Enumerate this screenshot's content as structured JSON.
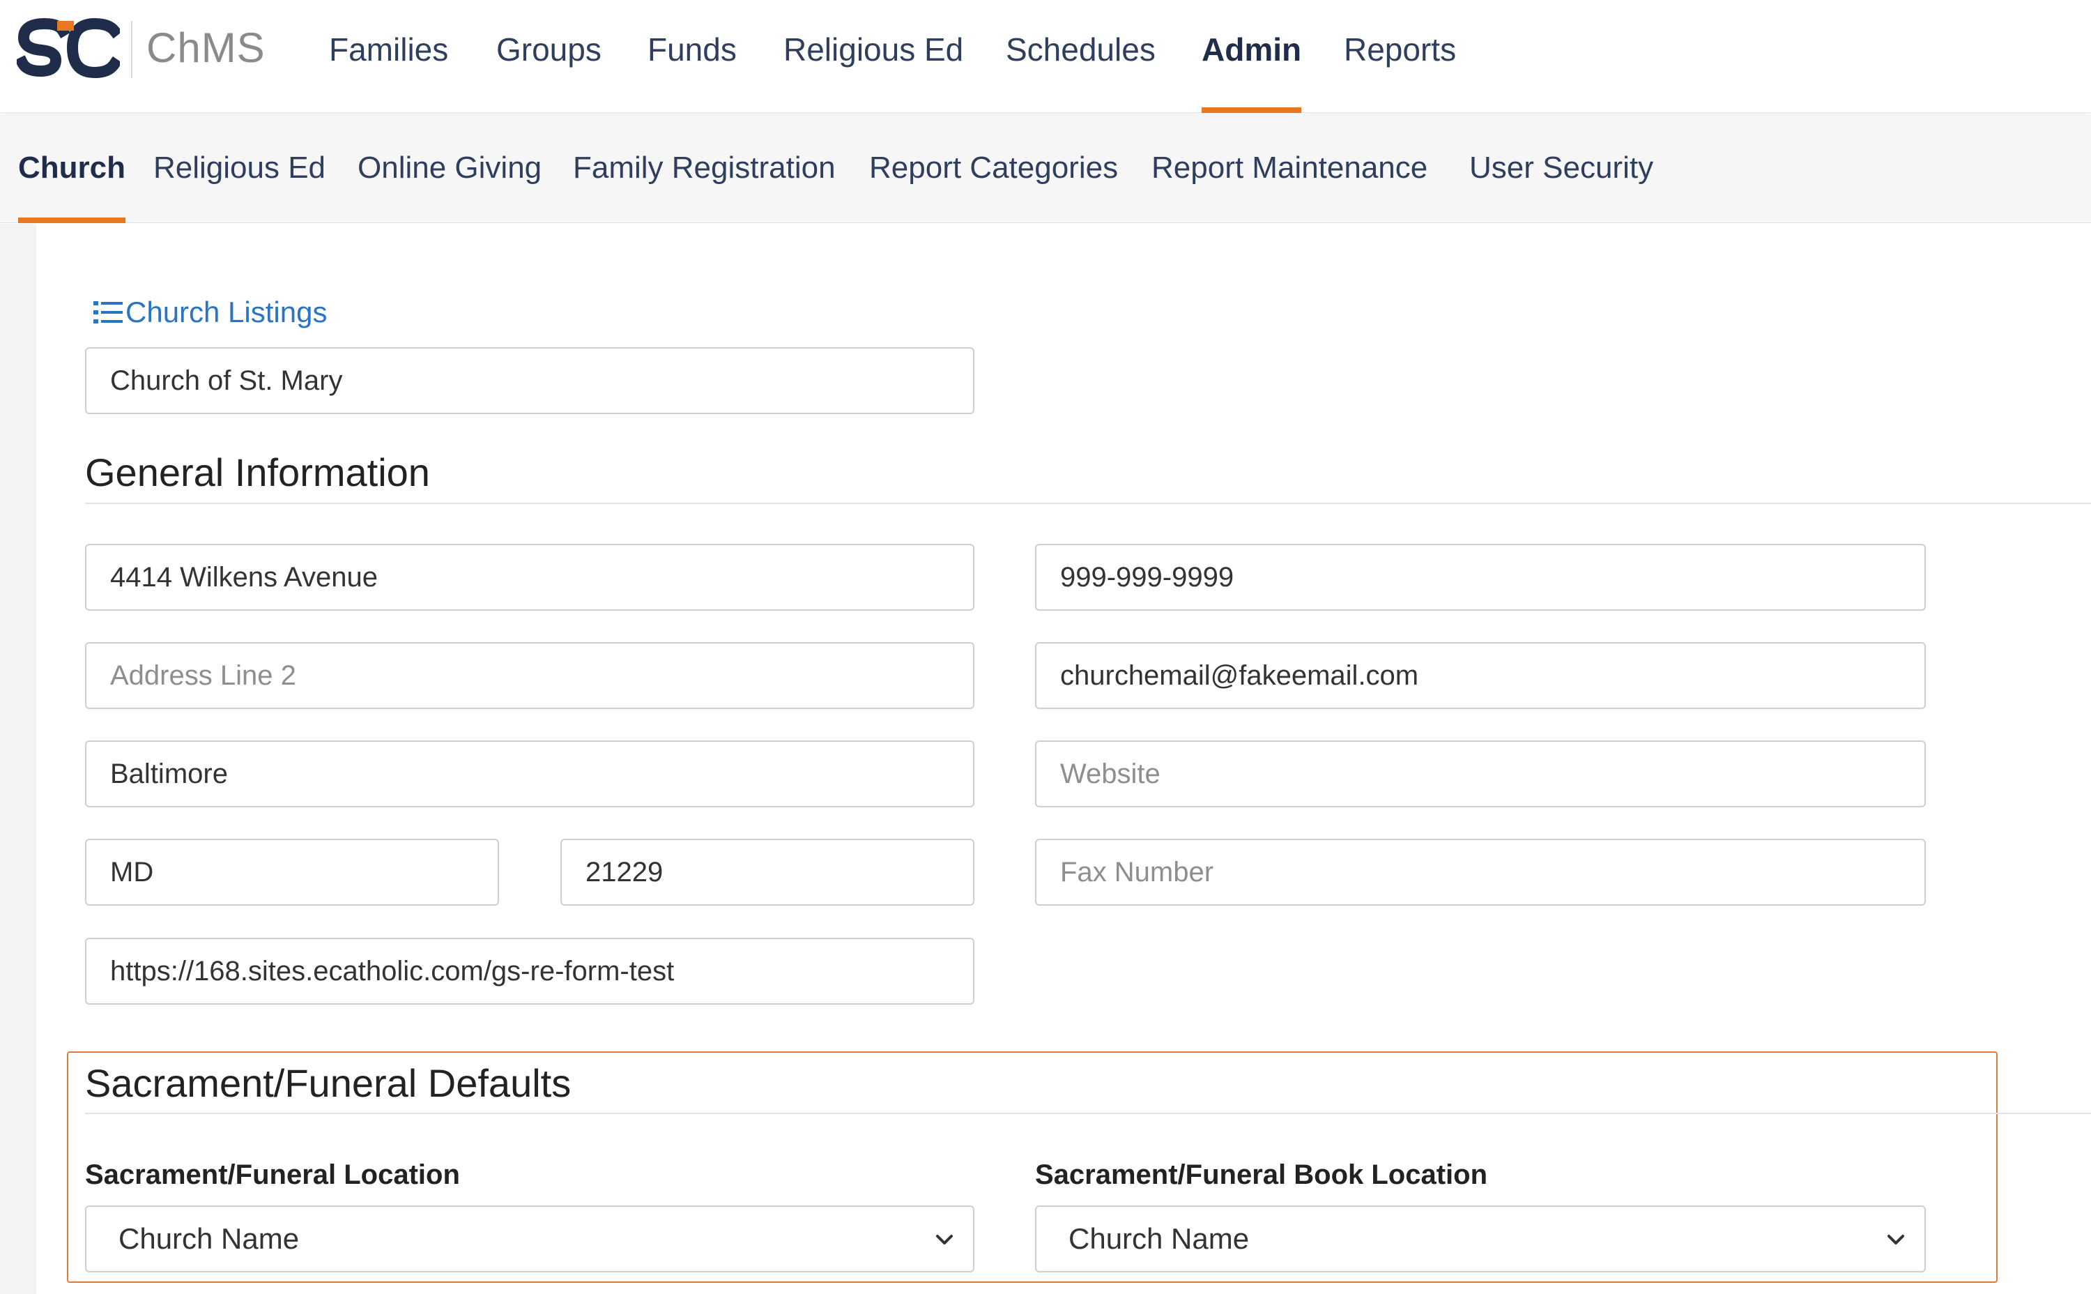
{
  "app": {
    "brand_letters": "SC",
    "name": "ChMS"
  },
  "topnav": {
    "items": [
      {
        "label": "Families"
      },
      {
        "label": "Groups"
      },
      {
        "label": "Funds"
      },
      {
        "label": "Religious Ed"
      },
      {
        "label": "Schedules"
      },
      {
        "label": "Admin",
        "active": true
      },
      {
        "label": "Reports"
      }
    ]
  },
  "subnav": {
    "items": [
      {
        "label": "Church",
        "active": true
      },
      {
        "label": "Religious Ed"
      },
      {
        "label": "Online Giving"
      },
      {
        "label": "Family Registration"
      },
      {
        "label": "Report Categories"
      },
      {
        "label": "Report Maintenance"
      },
      {
        "label": "User Security"
      }
    ]
  },
  "church": {
    "listings_link": "Church Listings",
    "name_value": "Church of St. Mary"
  },
  "general": {
    "title": "General Information",
    "address1": "4414 Wilkens Avenue",
    "address2_placeholder": "Address Line 2",
    "city": "Baltimore",
    "state": "MD",
    "zip": "21229",
    "url": "https://168.sites.ecatholic.com/gs-re-form-test",
    "phone": "999-999-9999",
    "email": "churchemail@fakeemail.com",
    "website_placeholder": "Website",
    "fax_placeholder": "Fax Number"
  },
  "sacrament": {
    "title": "Sacrament/Funeral Defaults",
    "location_label": "Sacrament/Funeral Location",
    "location_value": "Church Name",
    "book_location_label": "Sacrament/Funeral Book Location",
    "book_location_value": "Church Name"
  },
  "colors": {
    "accent": "#e87722",
    "nav_text": "#2f3e5c",
    "link": "#2a74c4",
    "highlight_border": "#e07a38"
  },
  "icons": {
    "listings": "list-icon",
    "select_caret": "chevron-down-icon"
  }
}
